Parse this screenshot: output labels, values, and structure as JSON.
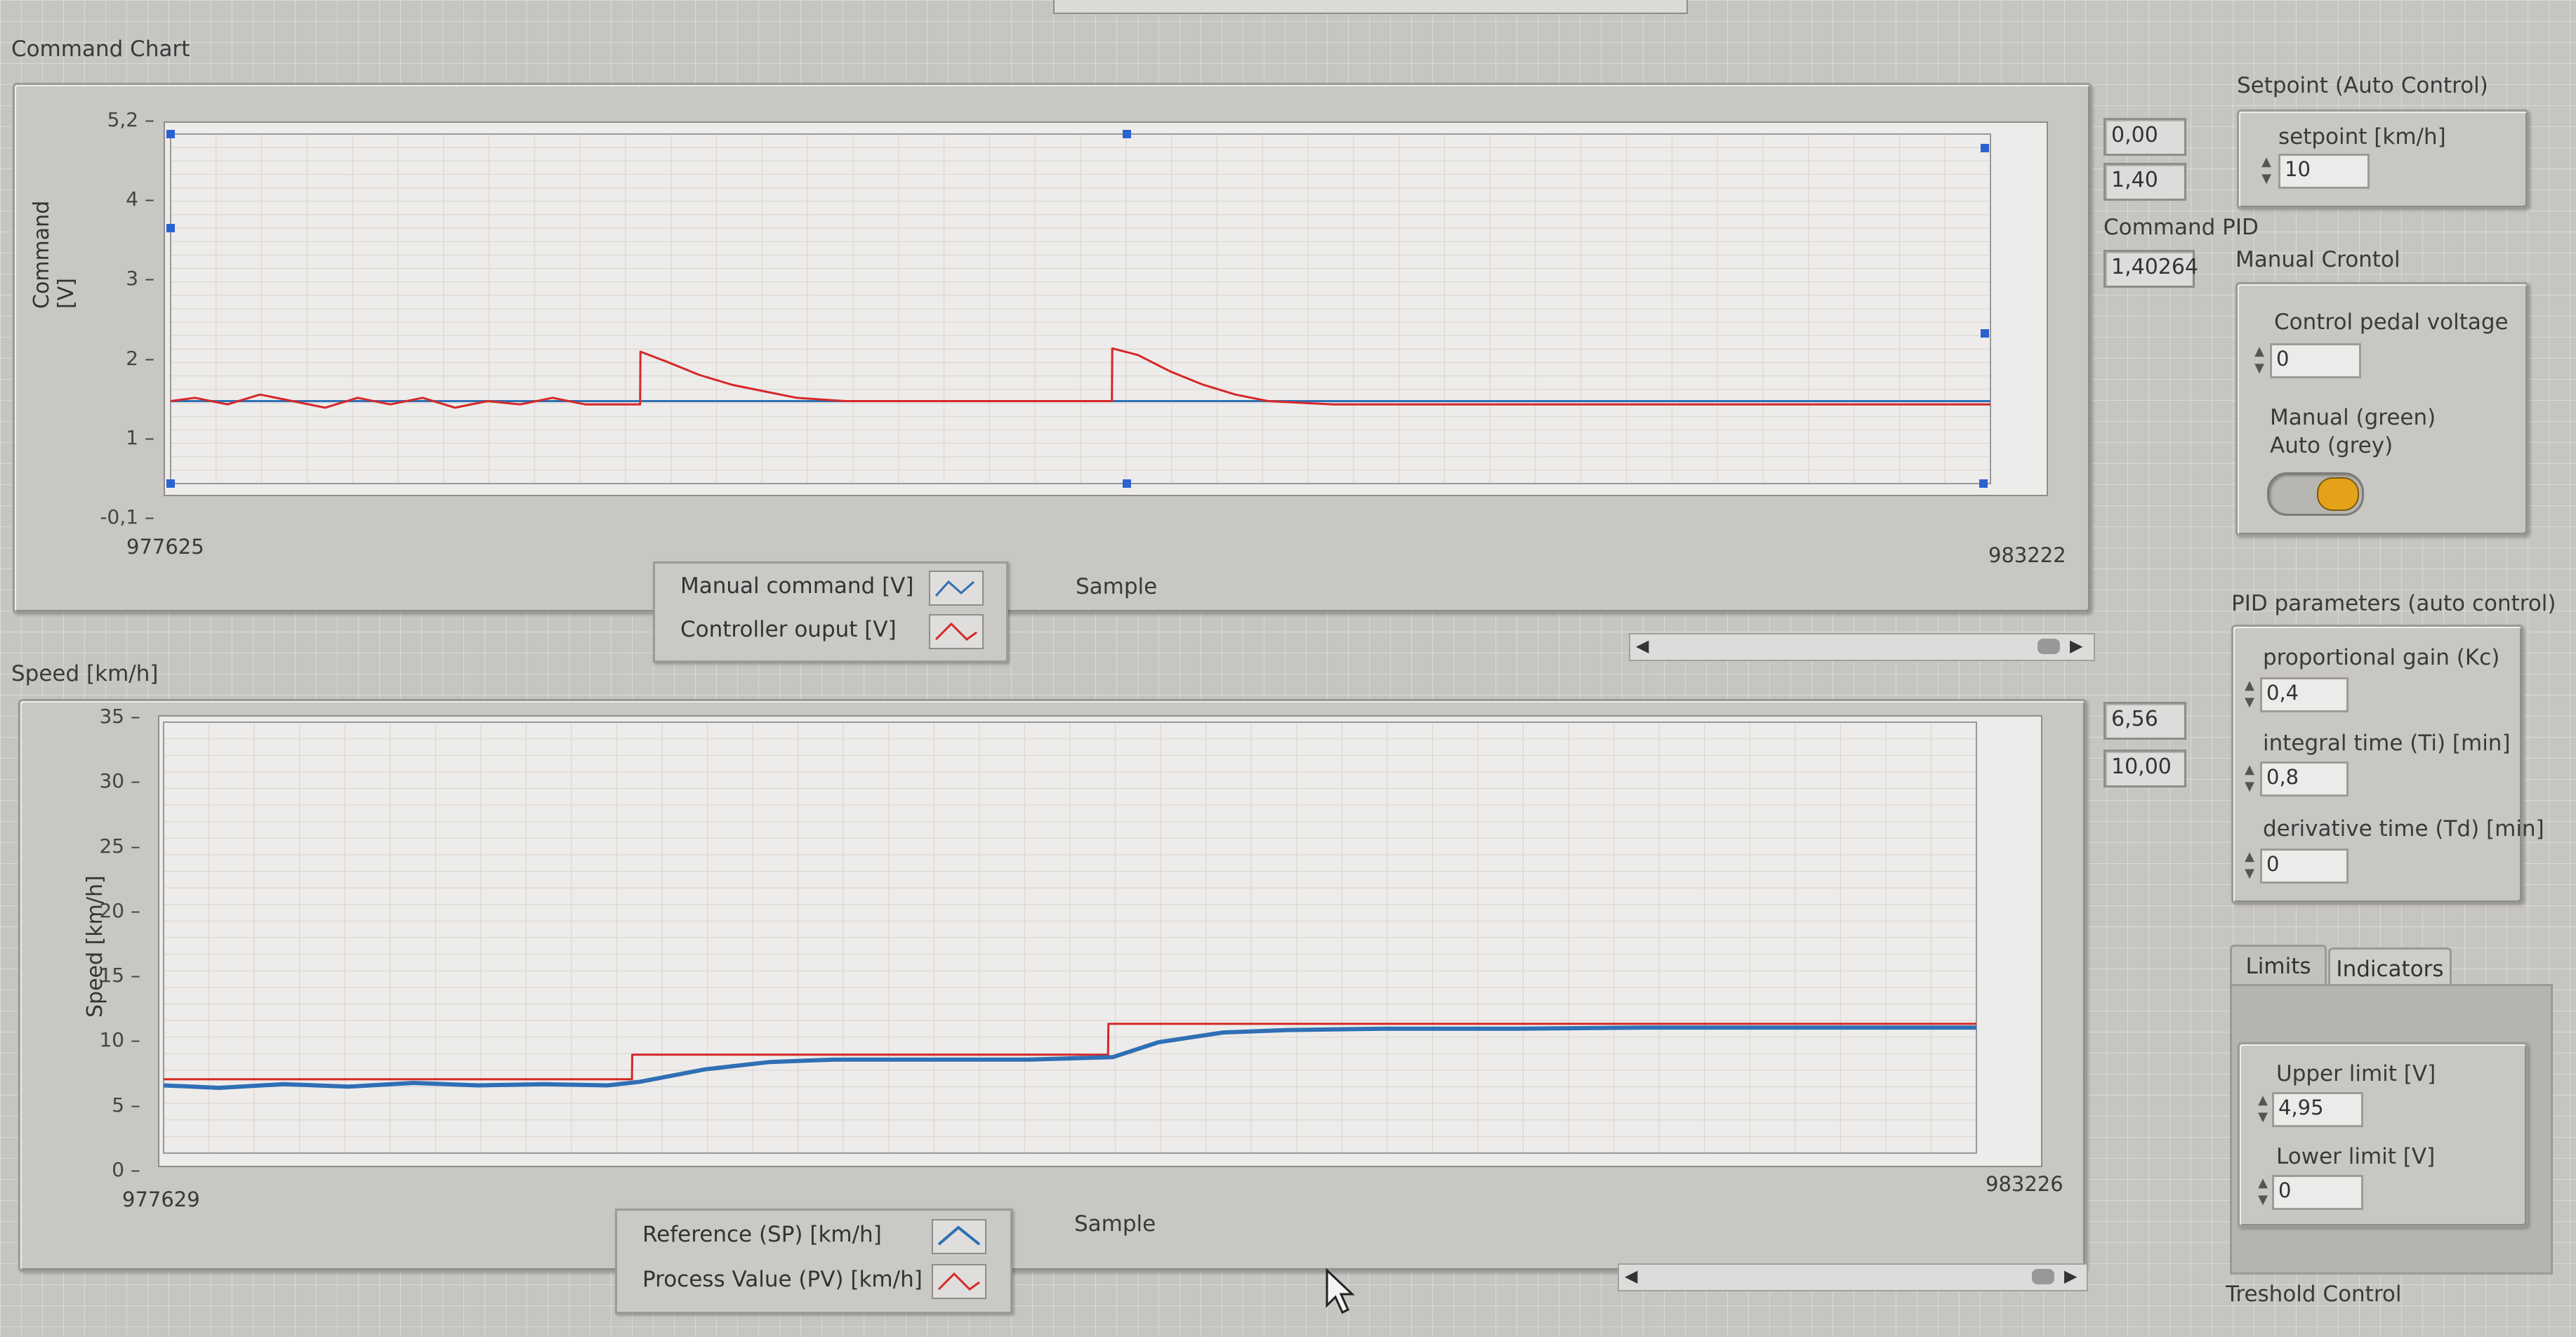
{
  "command_chart": {
    "title": "Command Chart",
    "ylabel": "Command [V]",
    "xlabel": "Sample",
    "y_ticks": [
      "5,2",
      "4",
      "3",
      "2",
      "1",
      "-0,1"
    ],
    "x_start": "977625",
    "x_end": "983222",
    "legend": [
      "Manual command [V]",
      "Controller ouput [V]"
    ],
    "readouts": [
      "0,00",
      "1,40"
    ],
    "colors": {
      "manual": "#2f6fb5",
      "controller": "#d62828"
    }
  },
  "command_pid": {
    "label": "Command PID",
    "value": "1,40264"
  },
  "speed_chart": {
    "title": "Speed [km/h]",
    "ylabel": "Speed [km/h]",
    "xlabel": "Sample",
    "y_ticks": [
      "35",
      "30",
      "25",
      "20",
      "15",
      "10",
      "5",
      "0"
    ],
    "x_start": "977629",
    "x_end": "983226",
    "legend": [
      "Reference (SP) [km/h]",
      "Process Value (PV) [km/h]"
    ],
    "readouts": [
      "6,56",
      "10,00"
    ]
  },
  "setpoint": {
    "title": "Setpoint (Auto Control)",
    "label": "setpoint [km/h]",
    "value": "10"
  },
  "manual_control": {
    "title": "Manual Crontol",
    "label": "Control  pedal voltage",
    "value": "0",
    "mode_line1": "Manual (green)",
    "mode_line2": "Auto (grey)"
  },
  "pid": {
    "title": "PID parameters (auto control)",
    "kc_label": "proportional gain (Kc)",
    "kc": "0,4",
    "ti_label": "integral time (Ti) [min]",
    "ti": "0,8",
    "td_label": "derivative time (Td) [min]",
    "td": "0"
  },
  "tabs": {
    "limits": "Limits",
    "indicators": "Indicators"
  },
  "limits": {
    "upper_label": "Upper limit [V]",
    "upper": "4,95",
    "lower_label": "Lower limit [V]",
    "lower": "0"
  },
  "threshold": {
    "title": "Treshold Control"
  },
  "chart_data": [
    {
      "type": "line",
      "xlabel": "Sample",
      "ylabel": "Command [V]",
      "xlim": [
        977625,
        983222
      ],
      "ylim": [
        -0.1,
        5.2
      ],
      "series": [
        {
          "name": "Manual command [V]",
          "x": [
            977625,
            983222
          ],
          "y": [
            1.15,
            1.15
          ]
        },
        {
          "name": "Controller ouput [V]",
          "x": [
            977625,
            977700,
            977800,
            977900,
            978000,
            978100,
            978200,
            978300,
            978400,
            978500,
            978600,
            978700,
            978800,
            978900,
            979069,
            979070,
            979150,
            979250,
            979350,
            979450,
            979550,
            979700,
            979900,
            980200,
            980520,
            980521,
            980600,
            980700,
            980800,
            980900,
            981000,
            981200,
            981500,
            981800,
            982100,
            982400,
            982700,
            983000,
            983222
          ],
          "y": [
            1.15,
            1.2,
            1.1,
            1.25,
            1.15,
            1.05,
            1.2,
            1.1,
            1.2,
            1.05,
            1.15,
            1.1,
            1.2,
            1.1,
            1.1,
            1.9,
            1.75,
            1.55,
            1.4,
            1.3,
            1.2,
            1.15,
            1.15,
            1.15,
            1.15,
            1.95,
            1.85,
            1.6,
            1.4,
            1.25,
            1.15,
            1.1,
            1.1,
            1.1,
            1.1,
            1.1,
            1.1,
            1.1,
            1.1
          ]
        }
      ]
    },
    {
      "type": "line",
      "xlabel": "Sample",
      "ylabel": "Speed [km/h]",
      "xlim": [
        977629,
        983226
      ],
      "ylim": [
        0,
        35
      ],
      "series": [
        {
          "name": "Reference (SP) [km/h]",
          "x": [
            977629,
            979075,
            979076,
            980545,
            980546,
            983226
          ],
          "y": [
            6.0,
            6.0,
            8.0,
            8.0,
            10.5,
            10.5
          ]
        },
        {
          "name": "Process Value (PV) [km/h]",
          "x": [
            977629,
            977800,
            978000,
            978200,
            978400,
            978600,
            978800,
            979000,
            979100,
            979300,
            979500,
            979700,
            980000,
            980300,
            980560,
            980700,
            980900,
            981100,
            981400,
            981800,
            982200,
            982600,
            983226
          ],
          "y": [
            5.5,
            5.3,
            5.6,
            5.4,
            5.7,
            5.5,
            5.6,
            5.5,
            5.8,
            6.8,
            7.4,
            7.6,
            7.6,
            7.6,
            7.8,
            9.0,
            9.8,
            10.0,
            10.1,
            10.1,
            10.2,
            10.2,
            10.2
          ]
        }
      ]
    }
  ]
}
